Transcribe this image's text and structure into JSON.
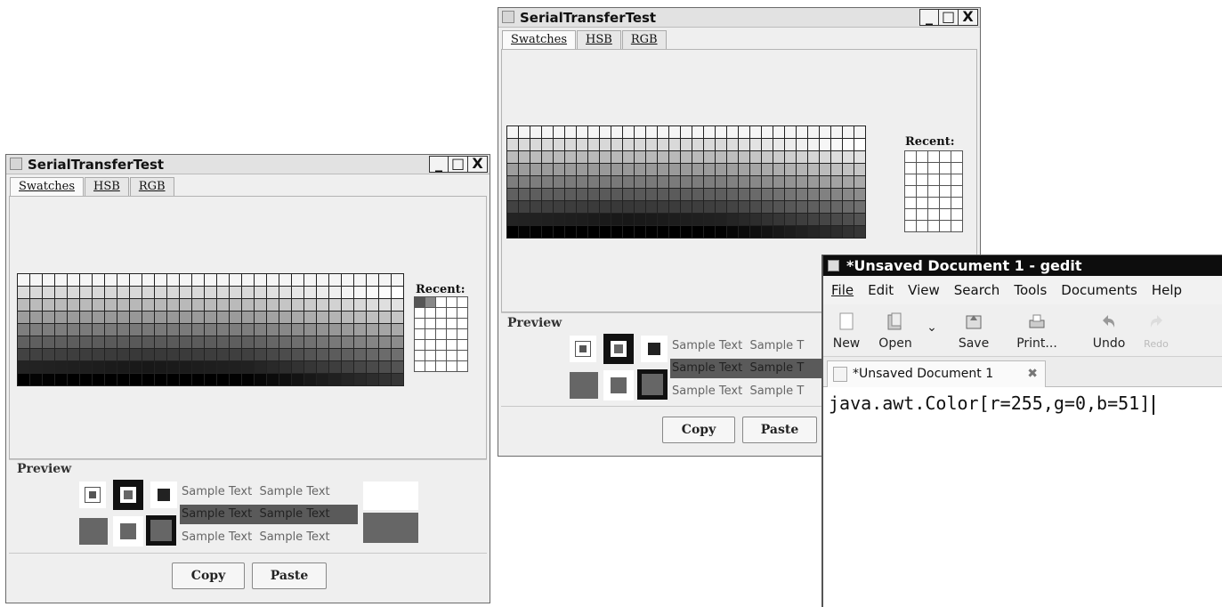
{
  "window_left": {
    "title": "SerialTransferTest",
    "controls": [
      "_",
      "□",
      "X"
    ],
    "tabs": [
      "Swatches",
      "HSB",
      "RGB"
    ],
    "recent_label": "Recent:",
    "preview_label": "Preview",
    "samples": [
      "Sample Text",
      "Sample Text",
      "Sample Text",
      "Sample Text",
      "Sample Text",
      "Sample Text"
    ],
    "copy": "Copy",
    "paste": "Paste"
  },
  "window_right": {
    "title": "SerialTransferTest",
    "controls": [
      "_",
      "□",
      "X"
    ],
    "tabs": [
      "Swatches",
      "HSB",
      "RGB"
    ],
    "recent_label": "Recent:",
    "preview_label": "Preview",
    "samples": [
      "Sample Text",
      "Sample T",
      "Sample Text",
      "Sample T",
      "Sample Text",
      "Sample T"
    ],
    "copy": "Copy",
    "paste": "Paste"
  },
  "gedit": {
    "title": "*Unsaved Document 1 - gedit",
    "menu": [
      "File",
      "Edit",
      "View",
      "Search",
      "Tools",
      "Documents",
      "Help"
    ],
    "toolbar": [
      "New",
      "Open",
      "Save",
      "Print...",
      "Undo",
      "Redo"
    ],
    "tab_label": "*Unsaved Document 1",
    "text": "java.awt.Color[r=255,g=0,b=51]"
  },
  "colors": {
    "title_bar": "#0d0d0d",
    "selection": "#5a5a5a",
    "swatch_dark": "#222222"
  }
}
